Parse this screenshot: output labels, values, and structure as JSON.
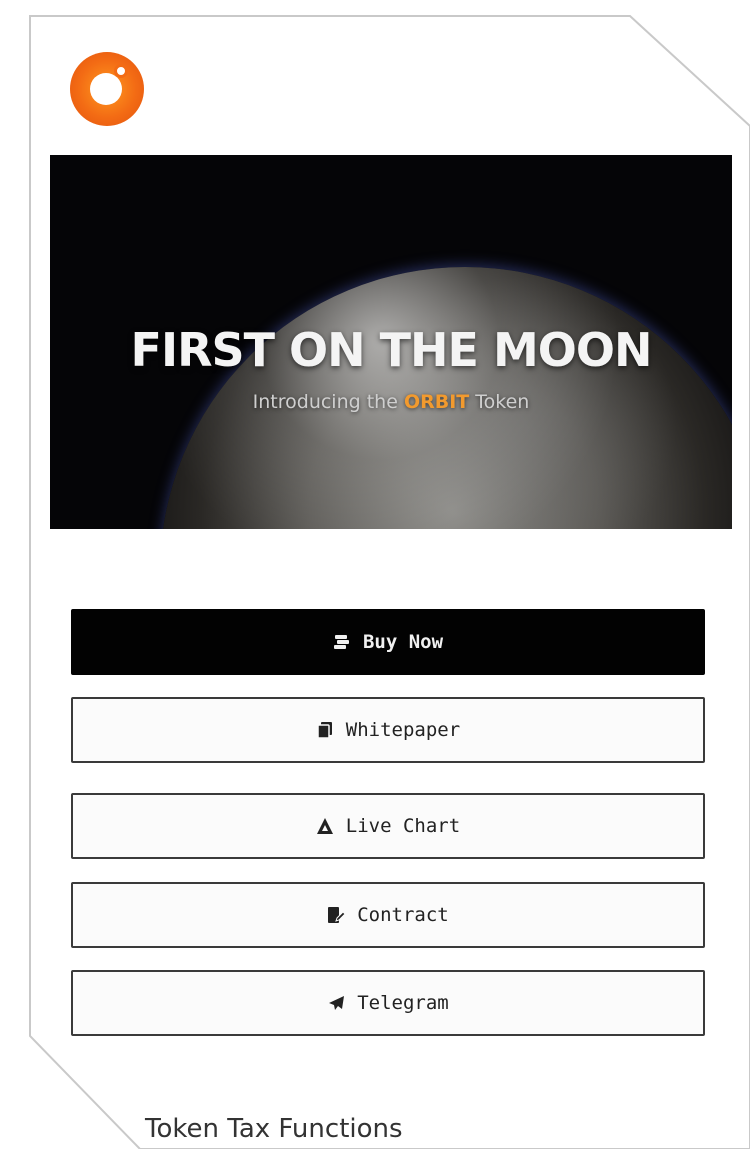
{
  "hero": {
    "title": "FIRST ON THE MOON",
    "subtitle_pre": "Introducing the ",
    "subtitle_accent": "ORBIT",
    "subtitle_post": " Token"
  },
  "buttons": [
    {
      "label": "Buy Now",
      "icon": "coins-icon"
    },
    {
      "label": "Whitepaper",
      "icon": "copy-icon"
    },
    {
      "label": "Live Chart",
      "icon": "mountain-chart-icon"
    },
    {
      "label": "Contract",
      "icon": "file-signature-icon"
    },
    {
      "label": "Telegram",
      "icon": "paper-plane-icon"
    }
  ],
  "section": {
    "title": "Token Tax Functions"
  },
  "colors": {
    "accent": "#f29a2e",
    "logo": "#f36b14",
    "primary_button": "#020202"
  }
}
